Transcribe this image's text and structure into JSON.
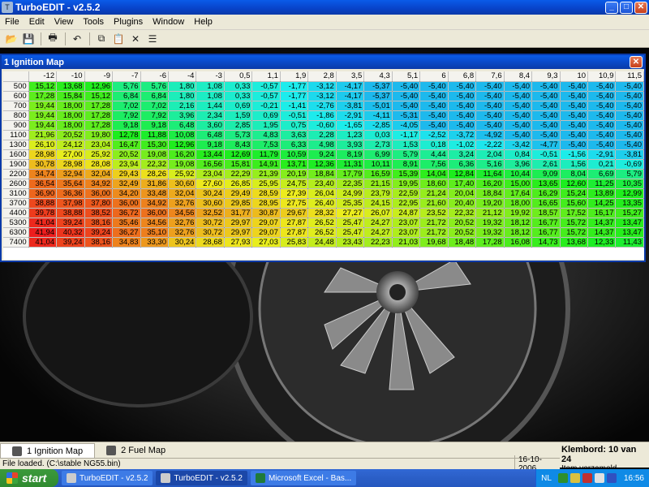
{
  "app": {
    "title": "TurboEDIT - v2.5.2"
  },
  "window_controls": {
    "minimize": "_",
    "maximize": "□",
    "close": "✕"
  },
  "menu": [
    "File",
    "Edit",
    "View",
    "Tools",
    "Plugins",
    "Window",
    "Help"
  ],
  "toolbar": {
    "icons": [
      "open-icon",
      "save-icon",
      "print-icon",
      "undo-icon",
      "copy-icon",
      "paste-icon",
      "delete-icon",
      "properties-icon"
    ]
  },
  "mdi": {
    "title": "1 Ignition Map",
    "close": "✕"
  },
  "table": {
    "columns": [
      "-12",
      "-10",
      "-9",
      "-7",
      "-6",
      "-4",
      "-3",
      "0,5",
      "1,1",
      "1,9",
      "2,8",
      "3,5",
      "4,3",
      "5,1",
      "6",
      "6,8",
      "7,6",
      "8,4",
      "9,3",
      "10",
      "10,9",
      "11,5"
    ],
    "rows": [
      {
        "rpm": "500",
        "values": [
          "15,12",
          "13,68",
          "12,96",
          "5,76",
          "5,76",
          "1,80",
          "1,08",
          "0,33",
          "-0,57",
          "-1,77",
          "-3,12",
          "-4,17",
          "-5,37",
          "-5,40",
          "-5,40",
          "-5,40",
          "-5,40",
          "-5,40",
          "-5,40",
          "-5,40",
          "-5,40",
          "-5,40"
        ]
      },
      {
        "rpm": "600",
        "values": [
          "17,28",
          "15,84",
          "15,12",
          "6,84",
          "6,84",
          "1,80",
          "1,08",
          "0,33",
          "-0,57",
          "-1,77",
          "-3,12",
          "-4,17",
          "-5,37",
          "-5,40",
          "-5,40",
          "-5,40",
          "-5,40",
          "-5,40",
          "-5,40",
          "-5,40",
          "-5,40",
          "-5,40"
        ]
      },
      {
        "rpm": "700",
        "values": [
          "19,44",
          "18,00",
          "17,28",
          "7,02",
          "7,02",
          "2,16",
          "1,44",
          "0,69",
          "-0,21",
          "-1,41",
          "-2,76",
          "-3,81",
          "-5,01",
          "-5,40",
          "-5,40",
          "-5,40",
          "-5,40",
          "-5,40",
          "-5,40",
          "-5,40",
          "-5,40",
          "-5,40"
        ]
      },
      {
        "rpm": "800",
        "values": [
          "19,44",
          "18,00",
          "17,28",
          "7,92",
          "7,92",
          "3,96",
          "2,34",
          "1,59",
          "0,69",
          "-0,51",
          "-1,86",
          "-2,91",
          "-4,11",
          "-5,31",
          "-5,40",
          "-5,40",
          "-5,40",
          "-5,40",
          "-5,40",
          "-5,40",
          "-5,40",
          "-5,40"
        ]
      },
      {
        "rpm": "900",
        "values": [
          "19,44",
          "18,00",
          "17,28",
          "9,18",
          "9,18",
          "6,48",
          "3,60",
          "2,85",
          "1,95",
          "0,75",
          "-0,60",
          "-1,65",
          "-2,85",
          "-4,05",
          "-5,40",
          "-5,40",
          "-5,40",
          "-5,40",
          "-5,40",
          "-5,40",
          "-5,40",
          "-5,40"
        ]
      },
      {
        "rpm": "1100",
        "values": [
          "21,96",
          "20,52",
          "19,80",
          "12,78",
          "11,88",
          "10,08",
          "6,48",
          "5,73",
          "4,83",
          "3,63",
          "2,28",
          "1,23",
          "0,03",
          "-1,17",
          "-2,52",
          "-3,72",
          "-4,92",
          "-5,40",
          "-5,40",
          "-5,40",
          "-5,40",
          "-5,40"
        ]
      },
      {
        "rpm": "1300",
        "values": [
          "26,10",
          "24,12",
          "23,04",
          "16,47",
          "15,30",
          "12,96",
          "9,18",
          "8,43",
          "7,53",
          "6,33",
          "4,98",
          "3,93",
          "2,73",
          "1,53",
          "0,18",
          "-1,02",
          "-2,22",
          "-3,42",
          "-4,77",
          "-5,40",
          "-5,40",
          "-5,40"
        ]
      },
      {
        "rpm": "1600",
        "values": [
          "28,98",
          "27,00",
          "25,92",
          "20,52",
          "19,08",
          "16,20",
          "13,44",
          "12,69",
          "11,79",
          "10,59",
          "9,24",
          "8,19",
          "6,99",
          "5,79",
          "4,44",
          "3,24",
          "2,04",
          "0,84",
          "-0,51",
          "-1,56",
          "-2,91",
          "-3,81"
        ]
      },
      {
        "rpm": "1900",
        "values": [
          "30,78",
          "28,98",
          "28,08",
          "23,94",
          "22,32",
          "19,08",
          "16,56",
          "15,81",
          "14,91",
          "13,71",
          "12,36",
          "11,31",
          "10,11",
          "8,91",
          "7,56",
          "6,36",
          "5,16",
          "3,96",
          "2,61",
          "1,56",
          "0,21",
          "-0,69"
        ]
      },
      {
        "rpm": "2200",
        "values": [
          "34,74",
          "32,94",
          "32,04",
          "29,43",
          "28,26",
          "25,92",
          "23,04",
          "22,29",
          "21,39",
          "20,19",
          "18,84",
          "17,79",
          "16,59",
          "15,39",
          "14,04",
          "12,84",
          "11,64",
          "10,44",
          "9,09",
          "8,04",
          "6,69",
          "5,79"
        ]
      },
      {
        "rpm": "2600",
        "values": [
          "36,54",
          "35,64",
          "34,92",
          "32,49",
          "31,86",
          "30,60",
          "27,60",
          "26,85",
          "25,95",
          "24,75",
          "23,40",
          "22,35",
          "21,15",
          "19,95",
          "18,60",
          "17,40",
          "16,20",
          "15,00",
          "13,65",
          "12,60",
          "11,25",
          "10,35"
        ]
      },
      {
        "rpm": "3100",
        "values": [
          "36,90",
          "36,36",
          "36,00",
          "34,20",
          "33,48",
          "32,04",
          "30,24",
          "29,49",
          "28,59",
          "27,39",
          "26,04",
          "24,99",
          "23,79",
          "22,59",
          "21,24",
          "20,04",
          "18,84",
          "17,64",
          "16,29",
          "15,24",
          "13,89",
          "12,99"
        ]
      },
      {
        "rpm": "3700",
        "values": [
          "38,88",
          "37,98",
          "37,80",
          "36,00",
          "34,92",
          "32,76",
          "30,60",
          "29,85",
          "28,95",
          "27,75",
          "26,40",
          "25,35",
          "24,15",
          "22,95",
          "21,60",
          "20,40",
          "19,20",
          "18,00",
          "16,65",
          "15,60",
          "14,25",
          "13,35"
        ]
      },
      {
        "rpm": "4400",
        "values": [
          "39,78",
          "38,88",
          "38,52",
          "36,72",
          "36,00",
          "34,56",
          "32,52",
          "31,77",
          "30,87",
          "29,67",
          "28,32",
          "27,27",
          "26,07",
          "24,87",
          "23,52",
          "22,32",
          "21,12",
          "19,92",
          "18,57",
          "17,52",
          "16,17",
          "15,27"
        ]
      },
      {
        "rpm": "5300",
        "values": [
          "41,04",
          "39,24",
          "38,16",
          "35,46",
          "34,56",
          "32,76",
          "30,72",
          "29,97",
          "29,07",
          "27,87",
          "26,52",
          "25,47",
          "24,27",
          "23,07",
          "21,72",
          "20,52",
          "19,32",
          "18,12",
          "16,77",
          "15,72",
          "14,37",
          "13,47"
        ]
      },
      {
        "rpm": "6300",
        "values": [
          "41,94",
          "40,32",
          "39,24",
          "36,27",
          "35,10",
          "32,76",
          "30,72",
          "29,97",
          "29,07",
          "27,87",
          "26,52",
          "25,47",
          "24,27",
          "23,07",
          "21,72",
          "20,52",
          "19,32",
          "18,12",
          "16,77",
          "15,72",
          "14,37",
          "13,47"
        ]
      },
      {
        "rpm": "7400",
        "values": [
          "41,04",
          "39,24",
          "38,16",
          "34,83",
          "33,30",
          "30,24",
          "28,68",
          "27,93",
          "27,03",
          "25,83",
          "24,48",
          "23,43",
          "22,23",
          "21,03",
          "19,68",
          "18,48",
          "17,28",
          "16,08",
          "14,73",
          "13,68",
          "12,33",
          "11,43"
        ]
      }
    ]
  },
  "tabs": [
    {
      "label": "1 Ignition Map",
      "active": true
    },
    {
      "label": "2 Fuel Map",
      "active": false
    }
  ],
  "clipboard": {
    "title": "Klembord: 10 van 24",
    "sub": "Item verzameld."
  },
  "status": {
    "text": "File loaded. (C:\\stable NG55.bin)",
    "date": "16-10-2006"
  },
  "taskbar": {
    "start": "start",
    "tasks": [
      {
        "label": "TurboEDIT - v2.5.2",
        "active": false
      },
      {
        "label": "TurboEDIT - v2.5.2",
        "active": true
      },
      {
        "label": "Microsoft Excel - Bas...",
        "active": false
      }
    ],
    "lang": "NL",
    "time": "16:56"
  }
}
